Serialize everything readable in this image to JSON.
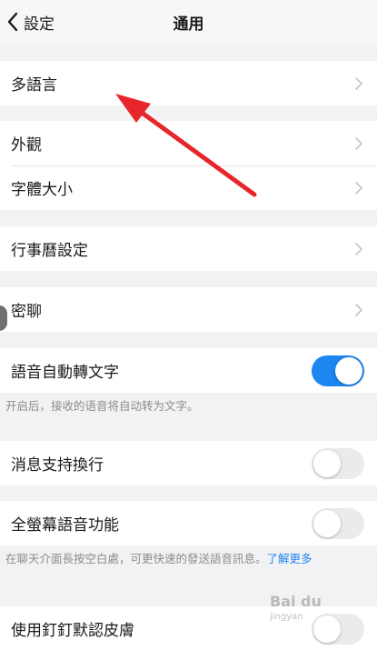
{
  "nav": {
    "back_label": "設定",
    "title": "通用"
  },
  "groups": [
    {
      "rows": [
        {
          "label": "多語言",
          "control": "chevron"
        }
      ]
    },
    {
      "rows": [
        {
          "label": "外觀",
          "control": "chevron"
        },
        {
          "label": "字體大小",
          "control": "chevron"
        }
      ]
    },
    {
      "rows": [
        {
          "label": "行事曆設定",
          "control": "chevron"
        }
      ]
    },
    {
      "rows": [
        {
          "label": "密聊",
          "control": "chevron"
        }
      ]
    },
    {
      "rows": [
        {
          "label": "語音自動轉文字",
          "control": "toggle",
          "on": true
        }
      ]
    },
    {
      "rows": [
        {
          "label": "消息支持換行",
          "control": "toggle",
          "on": false
        }
      ]
    },
    {
      "rows": [
        {
          "label": "全螢幕語音功能",
          "control": "toggle",
          "on": false
        }
      ]
    },
    {
      "rows": [
        {
          "label": "使用釘釘默認皮膚",
          "control": "toggle",
          "on": false
        }
      ]
    }
  ],
  "notes": {
    "voice_to_text": "开启后，接收的语音将自动转为文字。",
    "fullscreen_voice": "在聊天介面長按空白處，可更快速的發送語音訊息。",
    "fullscreen_voice_link": "了解更多"
  },
  "colors": {
    "accent": "#1d86f0",
    "annotation_arrow": "#e8252a",
    "background": "#f2f2f5"
  },
  "icons": {
    "back": "chevron-left-icon",
    "row_action": "chevron-right-icon"
  },
  "watermark": {
    "text": "Bai du",
    "sub": "jingyan"
  }
}
